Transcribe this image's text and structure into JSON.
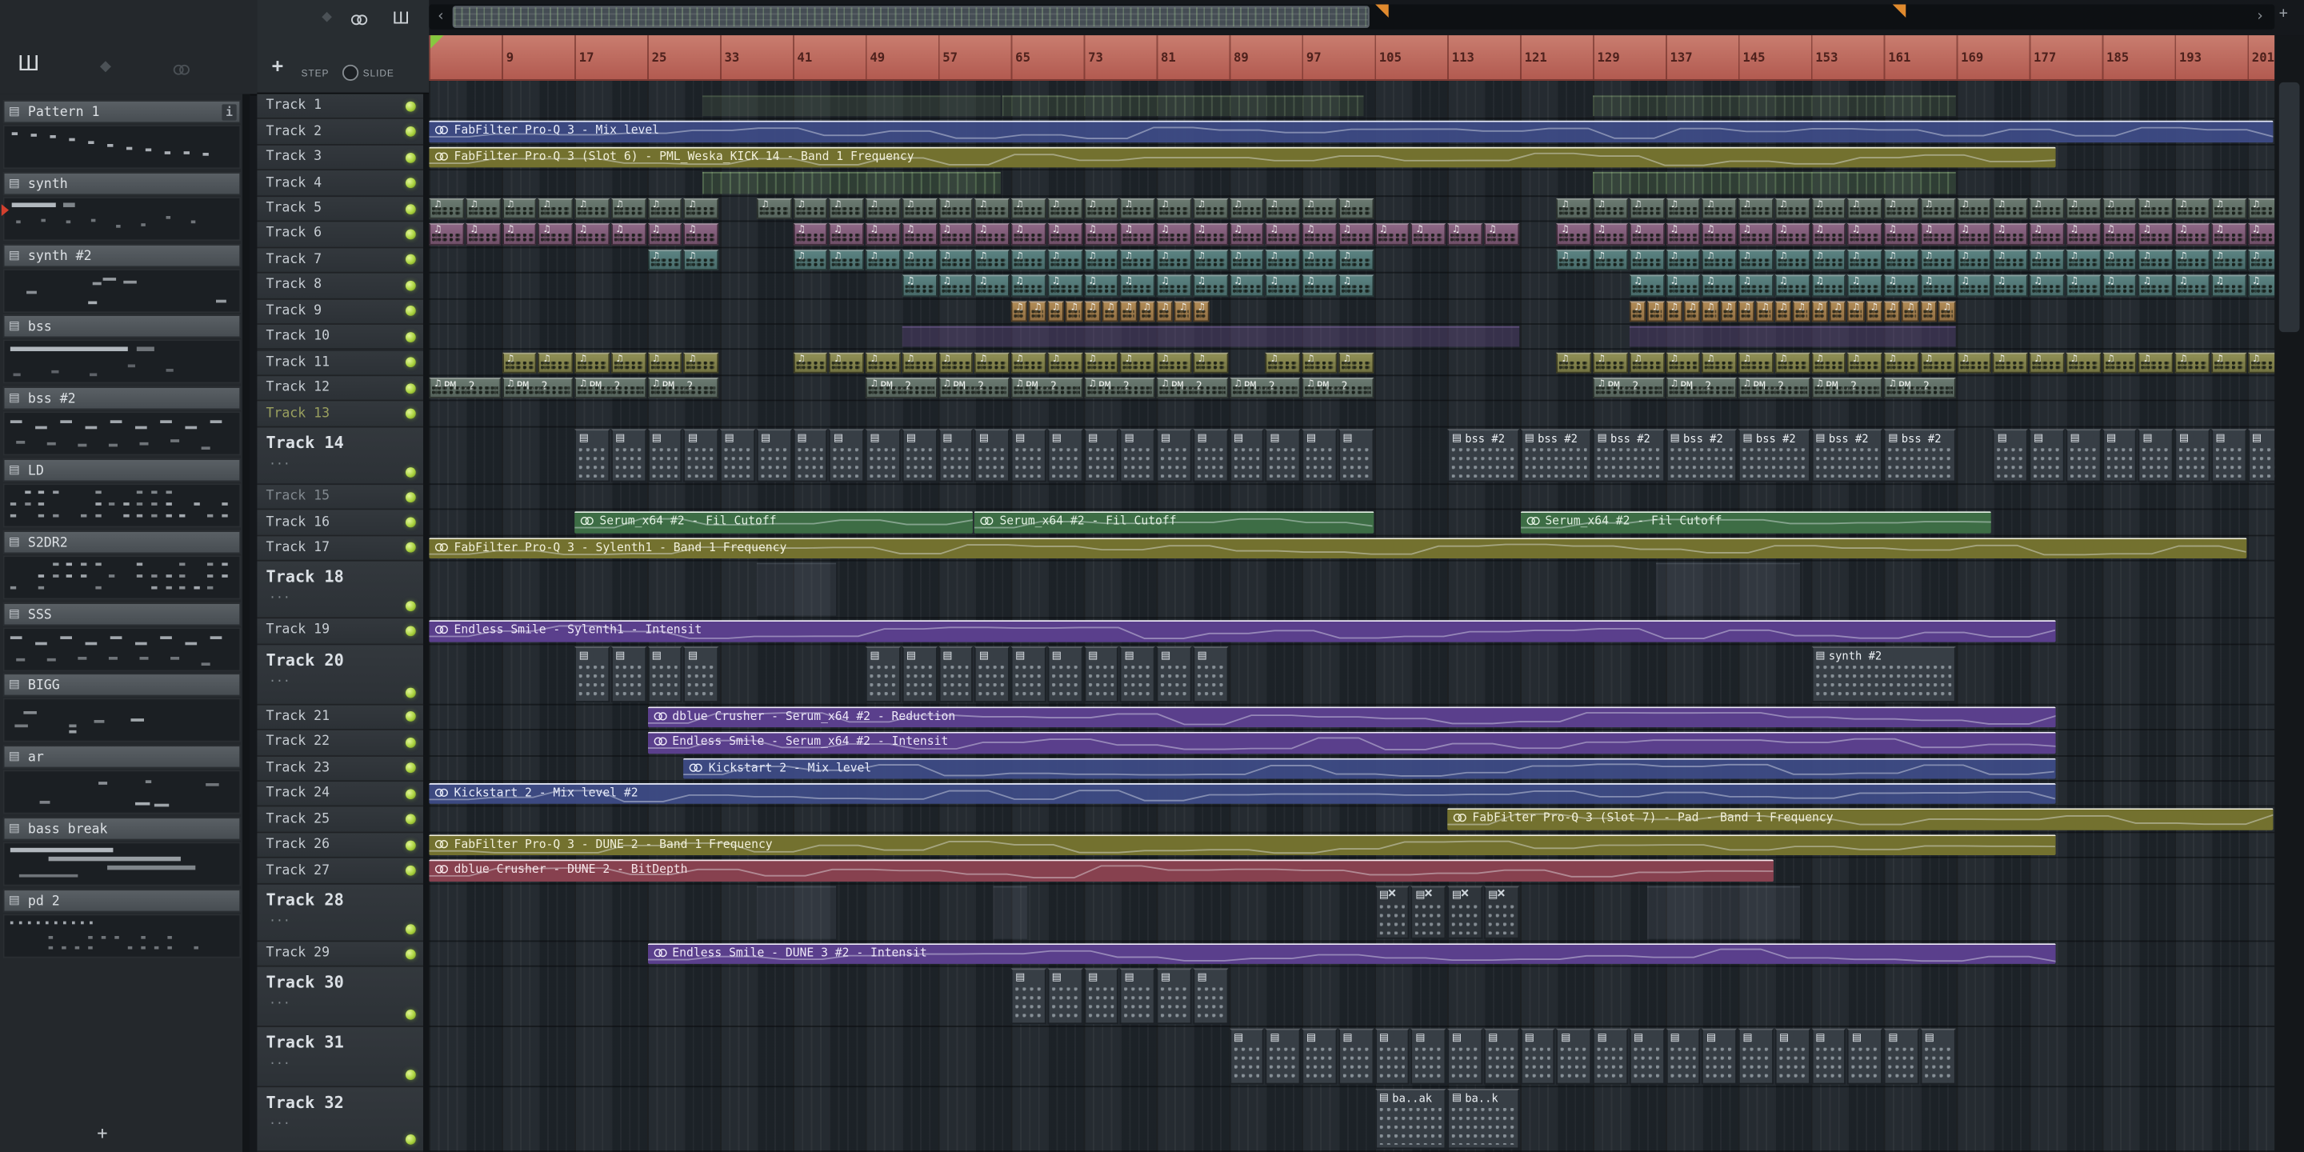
{
  "palette": {
    "ruler": "#c26a5f",
    "led": "#a9d23e",
    "blue": "#3e4c88",
    "olive": "#73712f",
    "green": "#3d6d45",
    "purple": "#5a3f8c",
    "maroon": "#87414f"
  },
  "left_toolbar": {
    "icons": [
      "picker-panel-icon",
      "diamond-icon",
      "link-icon"
    ]
  },
  "playlist_toolbar": {
    "add_label": "+",
    "step_label": "STEP",
    "slide_label": "SLIDE",
    "icons": [
      "diamond-icon",
      "link-icon",
      "playlist-icon"
    ]
  },
  "scrollbar": {
    "left_arrow": "‹",
    "right_arrow": "›",
    "zoom_label": "+",
    "markers": [
      {
        "bar": 105
      },
      {
        "bar": 162
      }
    ]
  },
  "patterns_panel": {
    "add_label": "+",
    "info_label": "i",
    "items": [
      {
        "name": "Pattern 1",
        "preview": "melody"
      },
      {
        "name": "synth",
        "preview": "blocks",
        "playing": true
      },
      {
        "name": "synth #2",
        "preview": "sparse"
      },
      {
        "name": "bss",
        "preview": "bar"
      },
      {
        "name": "bss #2",
        "preview": "dashes"
      },
      {
        "name": "LD",
        "preview": "dense"
      },
      {
        "name": "S2DR2",
        "preview": "dense"
      },
      {
        "name": "SSS",
        "preview": "dashes"
      },
      {
        "name": "BIGG",
        "preview": "sparse"
      },
      {
        "name": "ar",
        "preview": "sparse"
      },
      {
        "name": "bass break",
        "preview": "stairs"
      },
      {
        "name": "pd 2",
        "preview": "dots"
      }
    ]
  },
  "ruler": {
    "numbers": [
      9,
      17,
      25,
      33,
      41,
      49,
      57,
      65,
      73,
      81,
      89,
      97,
      105,
      113,
      121,
      129,
      137,
      145,
      153,
      161,
      169,
      177,
      185,
      193,
      201
    ]
  },
  "tracks": [
    {
      "name": "Track 1"
    },
    {
      "name": "Track 2"
    },
    {
      "name": "Track 3"
    },
    {
      "name": "Track 4"
    },
    {
      "name": "Track 5"
    },
    {
      "name": "Track 6"
    },
    {
      "name": "Track 7"
    },
    {
      "name": "Track 8"
    },
    {
      "name": "Track 9"
    },
    {
      "name": "Track 10"
    },
    {
      "name": "Track 11"
    },
    {
      "name": "Track 12"
    },
    {
      "name": "Track 13",
      "name_color": "#9aa05f"
    },
    {
      "name": "Track 14",
      "size": "tall",
      "sub": "..."
    },
    {
      "name": "Track 15",
      "name_color": "#82898f"
    },
    {
      "name": "Track 16"
    },
    {
      "name": "Track 17"
    },
    {
      "name": "Track 18",
      "size": "tall",
      "sub": "..."
    },
    {
      "name": "Track 19"
    },
    {
      "name": "Track 20",
      "size": "taller",
      "sub": "..."
    },
    {
      "name": "Track 21"
    },
    {
      "name": "Track 22"
    },
    {
      "name": "Track 23"
    },
    {
      "name": "Track 24"
    },
    {
      "name": "Track 25"
    },
    {
      "name": "Track 26"
    },
    {
      "name": "Track 27"
    },
    {
      "name": "Track 28",
      "size": "tall",
      "sub": "..."
    },
    {
      "name": "Track 29"
    },
    {
      "name": "Track 30",
      "size": "taller",
      "sub": "..."
    },
    {
      "name": "Track 31",
      "size": "taller",
      "sub": "..."
    },
    {
      "name": "Track 32",
      "size": "tallest",
      "sub": "..."
    }
  ],
  "clips": [
    {
      "t": 1,
      "b": 31,
      "l": 33,
      "ty": "dim",
      "c": "dimgreenA"
    },
    {
      "t": 1,
      "b": 64,
      "l": 40,
      "ty": "dim",
      "c": "dimgreenB"
    },
    {
      "t": 1,
      "b": 129,
      "l": 40,
      "ty": "dim",
      "c": "dimgreenB"
    },
    {
      "t": 2,
      "b": 1,
      "l": 203,
      "ty": "auto",
      "c": "blue",
      "label": "FabFilter Pro-Q 3 - Mix level"
    },
    {
      "t": 3,
      "b": 1,
      "l": 179,
      "ty": "auto",
      "c": "olive",
      "label": "FabFilter Pro-Q 3 (Slot 6) - PML_Weska_KICK 14 - Band 1 Frequency"
    },
    {
      "t": 4,
      "b": 31,
      "l": 33,
      "ty": "dim",
      "c": "hatchgreen"
    },
    {
      "t": 4,
      "b": 129,
      "l": 40,
      "ty": "dim",
      "c": "hatchgreen"
    },
    {
      "t": 5,
      "b": 1,
      "n": 8,
      "s": 4,
      "l": 4,
      "ty": "mini",
      "c": "slate"
    },
    {
      "t": 5,
      "b": 37,
      "n": 17,
      "s": 4,
      "l": 4,
      "ty": "mini",
      "c": "slate"
    },
    {
      "t": 5,
      "b": 125,
      "n": 20,
      "s": 4,
      "l": 4,
      "ty": "mini",
      "c": "slate"
    },
    {
      "t": 6,
      "b": 1,
      "n": 8,
      "s": 4,
      "l": 4,
      "ty": "mini",
      "c": "mauve"
    },
    {
      "t": 6,
      "b": 41,
      "n": 20,
      "s": 4,
      "l": 4,
      "ty": "mini",
      "c": "mauve"
    },
    {
      "t": 6,
      "b": 125,
      "n": 20,
      "s": 4,
      "l": 4,
      "ty": "mini",
      "c": "mauve"
    },
    {
      "t": 7,
      "b": 25,
      "n": 2,
      "s": 4,
      "l": 4,
      "ty": "mini",
      "c": "teal"
    },
    {
      "t": 7,
      "b": 41,
      "n": 16,
      "s": 4,
      "l": 4,
      "ty": "mini",
      "c": "teal"
    },
    {
      "t": 7,
      "b": 125,
      "n": 20,
      "s": 4,
      "l": 4,
      "ty": "mini",
      "c": "teal"
    },
    {
      "t": 8,
      "b": 53,
      "n": 13,
      "s": 4,
      "l": 4,
      "ty": "mini",
      "c": "teal"
    },
    {
      "t": 8,
      "b": 133,
      "n": 18,
      "s": 4,
      "l": 4,
      "ty": "mini",
      "c": "teal"
    },
    {
      "t": 9,
      "b": 65,
      "n": 11,
      "s": 2,
      "l": 2,
      "ty": "mini",
      "c": "tan"
    },
    {
      "t": 9,
      "b": 133,
      "n": 18,
      "s": 2,
      "l": 2,
      "ty": "mini",
      "c": "tan"
    },
    {
      "t": 10,
      "b": 53,
      "l": 68,
      "ty": "dim",
      "c": "dimpurple"
    },
    {
      "t": 10,
      "b": 133,
      "l": 36,
      "ty": "dim",
      "c": "dimpurple"
    },
    {
      "t": 11,
      "b": 9,
      "n": 6,
      "s": 4,
      "l": 4,
      "ty": "mini",
      "c": "olivemini"
    },
    {
      "t": 11,
      "b": 41,
      "n": 12,
      "s": 4,
      "l": 4,
      "ty": "mini",
      "c": "olivemini"
    },
    {
      "t": 11,
      "b": 93,
      "n": 3,
      "s": 4,
      "l": 4,
      "ty": "mini",
      "c": "olivemini"
    },
    {
      "t": 11,
      "b": 125,
      "n": 20,
      "s": 4,
      "l": 4,
      "ty": "mini",
      "c": "olivemini"
    },
    {
      "t": 12,
      "b": 1,
      "n": 4,
      "s": 8,
      "l": 8,
      "ty": "mini",
      "c": "slate",
      "label": "PM..2"
    },
    {
      "t": 12,
      "b": 49,
      "n": 7,
      "s": 8,
      "l": 8,
      "ty": "mini",
      "c": "slate",
      "label": "PM..2"
    },
    {
      "t": 12,
      "b": 129,
      "n": 5,
      "s": 8,
      "l": 8,
      "ty": "mini",
      "c": "slate",
      "label": "PM..2"
    },
    {
      "t": 14,
      "b": 17,
      "n": 22,
      "s": 4,
      "l": 4,
      "ty": "steps"
    },
    {
      "t": 14,
      "b": 113,
      "n": 7,
      "s": 8,
      "l": 8,
      "ty": "steps",
      "label": "bss #2"
    },
    {
      "t": 14,
      "b": 173,
      "n": 8,
      "s": 4,
      "l": 4,
      "ty": "steps"
    },
    {
      "t": 16,
      "b": 17,
      "l": 44,
      "ty": "auto",
      "c": "green",
      "label": "Serum_x64 #2 - Fil Cutoff"
    },
    {
      "t": 16,
      "b": 61,
      "l": 44,
      "ty": "auto",
      "c": "green",
      "label": "Serum_x64 #2 - Fil Cutoff"
    },
    {
      "t": 16,
      "b": 121,
      "l": 52,
      "ty": "auto",
      "c": "green",
      "label": "Serum_x64 #2 - Fil Cutoff"
    },
    {
      "t": 17,
      "b": 1,
      "l": 200,
      "ty": "auto",
      "c": "olive",
      "label": "FabFilter Pro-Q 3 - Sylenth1 - Band 1 Frequency"
    },
    {
      "t": 18,
      "b": 37,
      "l": 9,
      "ty": "dim",
      "c": "dimslate"
    },
    {
      "t": 18,
      "b": 136,
      "l": 16,
      "ty": "dim",
      "c": "dimslate"
    },
    {
      "t": 19,
      "b": 1,
      "l": 179,
      "ty": "auto",
      "c": "purple",
      "label": "Endless Smile - Sylenth1 - Intensit"
    },
    {
      "t": 20,
      "b": 17,
      "n": 4,
      "s": 4,
      "l": 4,
      "ty": "steps"
    },
    {
      "t": 20,
      "b": 49,
      "n": 10,
      "s": 4,
      "l": 4,
      "ty": "steps"
    },
    {
      "t": 20,
      "b": 153,
      "l": 16,
      "ty": "steps",
      "label": "synth #2"
    },
    {
      "t": 21,
      "b": 25,
      "l": 155,
      "ty": "auto",
      "c": "purple",
      "label": "dblue Crusher - Serum_x64 #2 - Reduction"
    },
    {
      "t": 22,
      "b": 25,
      "l": 155,
      "ty": "auto",
      "c": "purple",
      "label": "Endless Smile - Serum_x64 #2 - Intensit"
    },
    {
      "t": 23,
      "b": 29,
      "l": 151,
      "ty": "auto",
      "c": "blue",
      "label": "Kickstart 2 - Mix level"
    },
    {
      "t": 24,
      "b": 1,
      "l": 179,
      "ty": "auto",
      "c": "blue",
      "label": "Kickstart 2 - Mix level #2"
    },
    {
      "t": 25,
      "b": 113,
      "l": 91,
      "ty": "auto",
      "c": "olive",
      "label": "FabFilter Pro-Q 3 (Slot 7) - Pad - Band 1 Frequency"
    },
    {
      "t": 26,
      "b": 1,
      "l": 179,
      "ty": "auto",
      "c": "olive",
      "label": "FabFilter Pro-Q 3 - DUNE 2 - Band 1 Frequency"
    },
    {
      "t": 27,
      "b": 1,
      "l": 148,
      "ty": "auto",
      "c": "maroon",
      "label": "dblue Crusher - DUNE 2 - BitDepth"
    },
    {
      "t": 28,
      "b": 37,
      "l": 9,
      "ty": "dim",
      "c": "dimslate"
    },
    {
      "t": 28,
      "b": 63,
      "l": 4,
      "ty": "dim",
      "c": "dimslate"
    },
    {
      "t": 28,
      "b": 105,
      "n": 4,
      "s": 4,
      "l": 4,
      "ty": "steps",
      "muted": true
    },
    {
      "t": 28,
      "b": 135,
      "l": 17,
      "ty": "dim",
      "c": "dimslate"
    },
    {
      "t": 29,
      "b": 25,
      "l": 155,
      "ty": "auto",
      "c": "purple",
      "label": "Endless Smile - DUNE 3 #2 - Intensit"
    },
    {
      "t": 30,
      "b": 65,
      "n": 6,
      "s": 4,
      "l": 4,
      "ty": "steps"
    },
    {
      "t": 31,
      "b": 89,
      "n": 20,
      "s": 4,
      "l": 4,
      "ty": "steps"
    },
    {
      "t": 32,
      "b": 105,
      "l": 8,
      "ty": "steps",
      "label": "ba..ak"
    },
    {
      "t": 32,
      "b": 113,
      "l": 8,
      "ty": "steps",
      "label": "ba..k"
    }
  ]
}
